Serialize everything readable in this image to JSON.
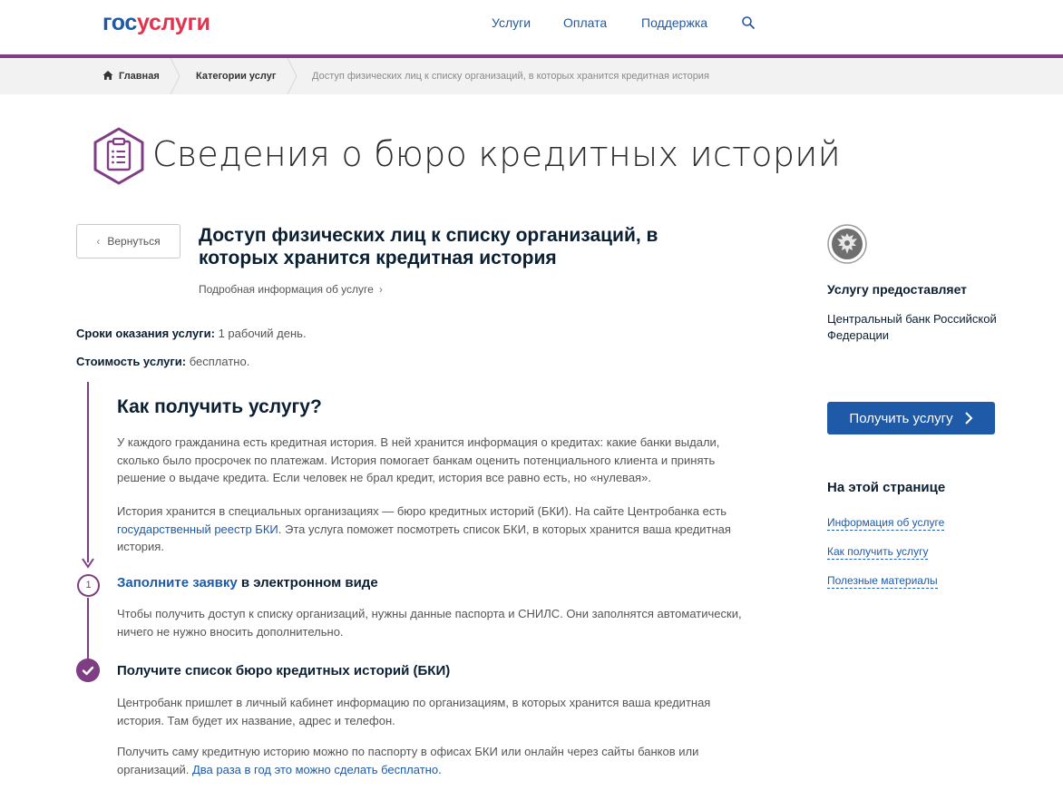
{
  "header": {
    "logo_part1": "гос",
    "logo_part2": "услуги",
    "nav": [
      "Услуги",
      "Оплата",
      "Поддержка"
    ]
  },
  "breadcrumb": {
    "home": "Главная",
    "category": "Категории услуг",
    "current": "Доступ физических лиц к списку организаций, в которых хранится кредитная история"
  },
  "page_title": "Сведения о бюро кредитных историй",
  "back_label": "Вернуться",
  "service": {
    "heading": "Доступ физических лиц к списку организаций, в которых хранится кредитная история",
    "detail_link": "Подробная информация об услуге",
    "terms_time_label": "Сроки оказания услуги:",
    "terms_time_value": " 1 рабочий день.",
    "terms_cost_label": "Стоимость услуги:",
    "terms_cost_value": " бесплатно."
  },
  "how": {
    "heading": "Как получить услугу?",
    "p1": "У каждого гражданина есть кредитная история. В ней хранится информация о кредитах: какие банки выдали, сколько было просрочек по платежам. История помогает банкам оценить потенциального клиента и принять решение о выдаче кредита. Если человек не брал кредит, история все равно есть, но «нулевая».",
    "p2_before": "История хранится в специальных организациях — бюро кредитных историй (БКИ). На сайте Центробанка есть ",
    "p2_link": "государственный реестр БКИ",
    "p2_after": ". Эта услуга поможет посмотреть список БКИ, в которых хранится ваша кредитная история."
  },
  "steps": {
    "step1_number": "1",
    "step1_link": "Заполните заявку",
    "step1_rest": " в электронном виде",
    "step1_text": "Чтобы получить доступ к списку организаций, нужны данные паспорта и СНИЛС. Они заполнятся автоматически, ничего не нужно вносить дополнительно.",
    "step2_title": "Получите список бюро кредитных историй (БКИ)",
    "step2_text": "Центробанк пришлет в личный кабинет информацию по организациям, в которых хранится ваша кредитная история. Там будет их название, адрес и телефон.",
    "step2_extra_before": "Получить саму кредитную историю можно по паспорту в офисах БКИ или онлайн через сайты банков или организаций. ",
    "step2_extra_link": "Два раза в год это можно сделать бесплатно."
  },
  "sidebar": {
    "provider_label": "Услугу предоставляет",
    "provider_name": "Центральный банк Российской Федерации",
    "get_button": "Получить услугу",
    "on_page_heading": "На этой странице",
    "toc": [
      "Информация об услуге",
      "Как получить услугу",
      "Полезные материалы"
    ]
  },
  "colors": {
    "brand_blue": "#1e5aa8",
    "brand_red": "#e3324d",
    "accent_purple": "#7f3d84"
  }
}
